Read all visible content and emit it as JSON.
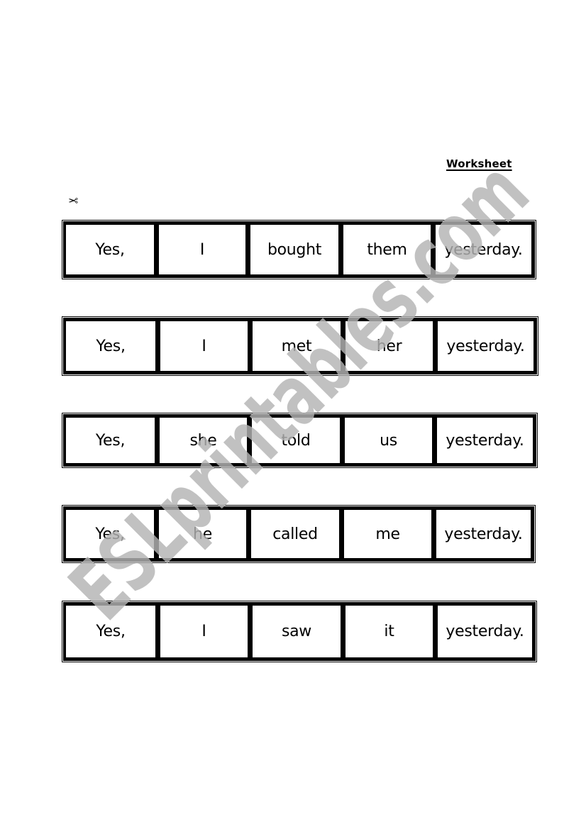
{
  "document": {
    "title": "Worksheet",
    "cut_marker_icon": "scissors-icon",
    "cut_marker_glyph": "✂",
    "watermark": "ESLprintables.com",
    "sentence_strips": [
      {
        "words": [
          "Yes,",
          "I",
          "bought",
          "them",
          "yesterday."
        ]
      },
      {
        "words": [
          "Yes,",
          "I",
          "met",
          "her",
          "yesterday."
        ]
      },
      {
        "words": [
          "Yes,",
          "she",
          "told",
          "us",
          "yesterday."
        ]
      },
      {
        "words": [
          "Yes,",
          "he",
          "called",
          "me",
          "yesterday."
        ]
      },
      {
        "words": [
          "Yes,",
          "I",
          "saw",
          "it",
          "yesterday."
        ]
      }
    ]
  }
}
